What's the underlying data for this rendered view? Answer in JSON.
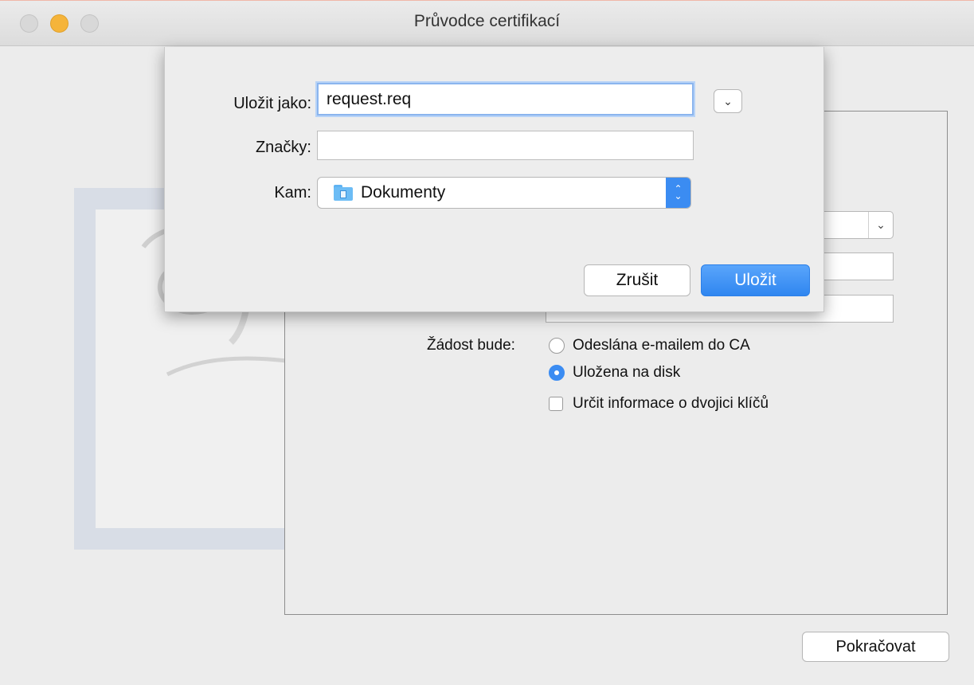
{
  "window": {
    "title": "Průvodce certifikací"
  },
  "sheet": {
    "save_as_label": "Uložit jako:",
    "save_as_value": "request.req",
    "tags_label": "Značky:",
    "tags_value": "",
    "where_label": "Kam:",
    "where_value": "Dokumenty",
    "cancel_label": "Zrušit",
    "save_label": "Uložit"
  },
  "form": {
    "request_label": "Žádost bude:",
    "options": [
      {
        "label": "Odeslána e-mailem do CA",
        "checked": false
      },
      {
        "label": "Uložena na disk",
        "checked": true
      }
    ],
    "key_pair_checkbox": {
      "label": "Určit informace o dvojici klíčů",
      "checked": false
    }
  },
  "footer": {
    "continue_label": "Pokračovat"
  },
  "colors": {
    "accent": "#3b8cf2",
    "minimize": "#f5b43a"
  },
  "icons": {
    "folder": "folder-icon",
    "expand": "chevron-down-icon",
    "stepper": "updown-chevron-icon"
  }
}
